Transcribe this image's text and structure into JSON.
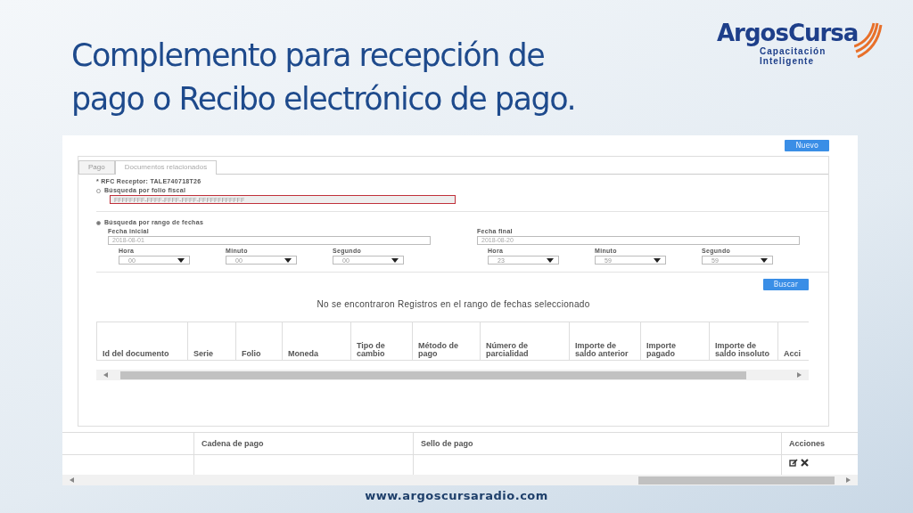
{
  "slide": {
    "title_lines": [
      "Complemento para recepción de",
      "pago o Recibo electrónico de pago."
    ],
    "logo": {
      "name": "ArgosCursa",
      "tagline_lines": [
        "Capacitación",
        "Inteligente"
      ]
    },
    "footer": "www.argoscursaradio.com"
  },
  "app": {
    "new_button": "Nuevo",
    "tabs": [
      {
        "label": "Pago",
        "selected": false
      },
      {
        "label": "Documentos relacionados",
        "selected": true
      }
    ],
    "rfc": "* RFC Receptor: TALE740718T26",
    "search_modes": [
      {
        "label": "Búsqueda por folio fiscal",
        "selected": false
      },
      {
        "label": "Búsqueda por rango de fechas",
        "selected": true
      }
    ],
    "folio_field": {
      "placeholder": "FFFFFFFF-FFFF-FFFF-FFFF-FFFFFFFFFFFF",
      "invalid": true
    },
    "date_ranges": [
      {
        "label": "Fecha inicial",
        "value": "2018-08-01",
        "time": [
          {
            "label": "Hora",
            "value": "00"
          },
          {
            "label": "Minuto",
            "value": "00"
          },
          {
            "label": "Segundo",
            "value": "00"
          }
        ]
      },
      {
        "label": "Fecha final",
        "value": "2018-08-20",
        "time": [
          {
            "label": "Hora",
            "value": "23"
          },
          {
            "label": "Minuto",
            "value": "59"
          },
          {
            "label": "Segundo",
            "value": "59"
          }
        ]
      }
    ],
    "search_button": "Buscar",
    "message": "No se encontraron Registros en el rango de fechas seleccionado",
    "documents_table": {
      "columns": [
        "Id del documento",
        "Serie",
        "Folio",
        "Moneda",
        "Tipo de cambio",
        "Método de pago",
        "Número de parcialidad",
        "Importe de saldo anterior",
        "Importe pagado",
        "Importe de saldo insoluto",
        "Acci"
      ]
    },
    "payments_table": {
      "columns": [
        "Cadena de pago",
        "Sello de pago",
        "Acciones"
      ]
    }
  }
}
